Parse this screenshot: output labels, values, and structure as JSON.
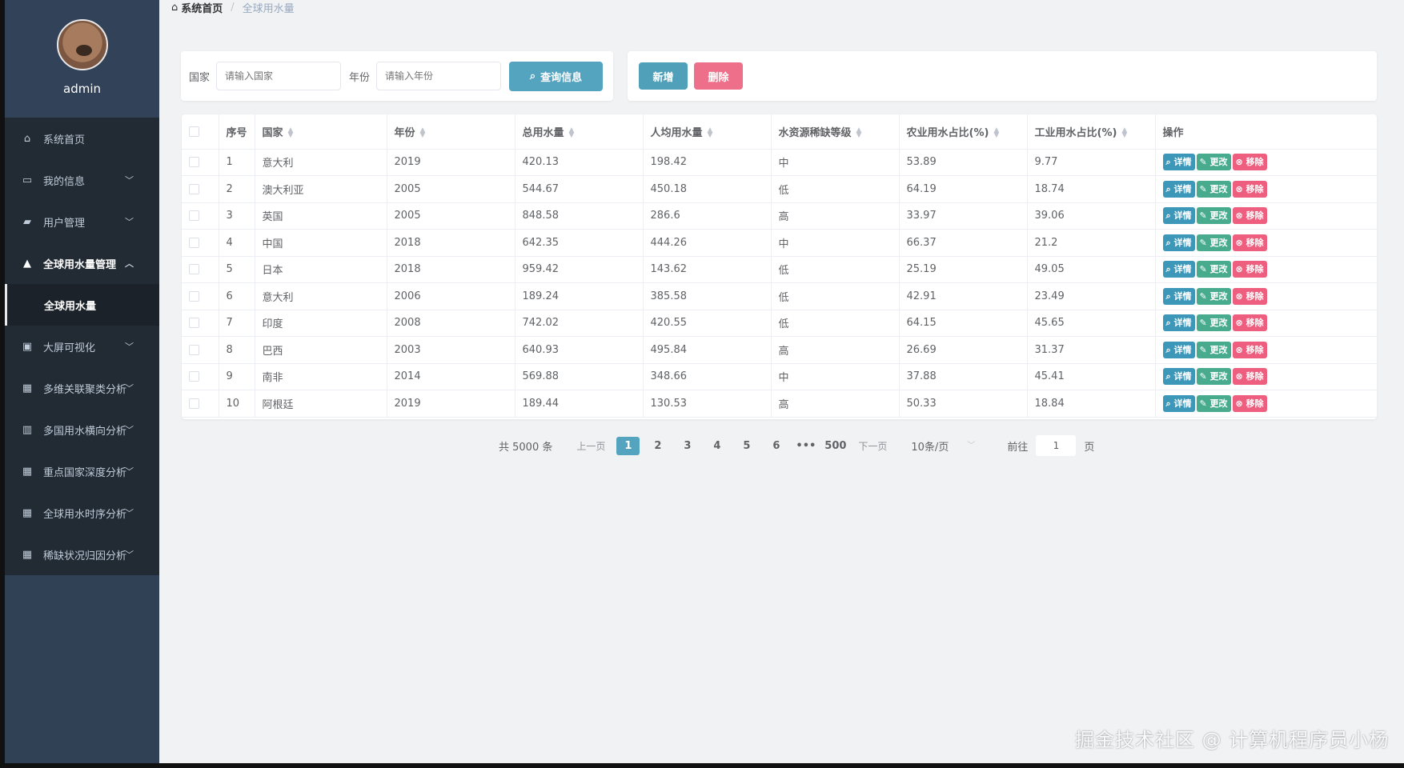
{
  "sidebar": {
    "username": "admin",
    "menu": [
      {
        "label": "系统首页",
        "icon": "home-icon",
        "glyph": "⌂",
        "caret": ""
      },
      {
        "label": "我的信息",
        "icon": "id-card-icon",
        "glyph": "▭",
        "caret": "﹀"
      },
      {
        "label": "用户管理",
        "icon": "user-group-icon",
        "glyph": "▰",
        "caret": "﹀"
      },
      {
        "label": "全球用水量管理",
        "icon": "user-icon",
        "glyph": "▲",
        "caret": "︿"
      }
    ],
    "submenu_label": "全球用水量",
    "menu_after": [
      {
        "label": "大屏可视化",
        "icon": "clipboard-icon",
        "glyph": "▣",
        "caret": "﹀"
      },
      {
        "label": "多维关联聚类分析",
        "icon": "grid-icon",
        "glyph": "▦",
        "caret": "﹀"
      },
      {
        "label": "多国用水横向分析",
        "icon": "book-icon",
        "glyph": "▥",
        "caret": "﹀"
      },
      {
        "label": "重点国家深度分析",
        "icon": "grid-icon",
        "glyph": "▦",
        "caret": "﹀"
      },
      {
        "label": "全球用水时序分析",
        "icon": "grid-icon",
        "glyph": "▦",
        "caret": "﹀"
      },
      {
        "label": "稀缺状况归因分析",
        "icon": "grid-icon",
        "glyph": "▦",
        "caret": "﹀"
      }
    ]
  },
  "breadcrumb": {
    "home": "系统首页",
    "current": "全球用水量"
  },
  "search": {
    "country_label": "国家",
    "country_placeholder": "请输入国家",
    "year_label": "年份",
    "year_placeholder": "请输入年份",
    "button_label": "查询信息"
  },
  "actions": {
    "add_label": "新增",
    "delete_label": "删除"
  },
  "table": {
    "columns": [
      "序号",
      "国家",
      "年份",
      "总用水量",
      "人均用水量",
      "水资源稀缺等级",
      "农业用水占比(%)",
      "工业用水占比(%)",
      "操作"
    ],
    "op_labels": {
      "detail": "详情",
      "edit": "更改",
      "remove": "移除"
    },
    "rows": [
      [
        "1",
        "意大利",
        "2019",
        "420.13",
        "198.42",
        "中",
        "53.89",
        "9.77"
      ],
      [
        "2",
        "澳大利亚",
        "2005",
        "544.67",
        "450.18",
        "低",
        "64.19",
        "18.74"
      ],
      [
        "3",
        "英国",
        "2005",
        "848.58",
        "286.6",
        "高",
        "33.97",
        "39.06"
      ],
      [
        "4",
        "中国",
        "2018",
        "642.35",
        "444.26",
        "中",
        "66.37",
        "21.2"
      ],
      [
        "5",
        "日本",
        "2018",
        "959.42",
        "143.62",
        "低",
        "25.19",
        "49.05"
      ],
      [
        "6",
        "意大利",
        "2006",
        "189.24",
        "385.58",
        "低",
        "42.91",
        "23.49"
      ],
      [
        "7",
        "印度",
        "2008",
        "742.02",
        "420.55",
        "低",
        "64.15",
        "45.65"
      ],
      [
        "8",
        "巴西",
        "2003",
        "640.93",
        "495.84",
        "高",
        "26.69",
        "31.37"
      ],
      [
        "9",
        "南非",
        "2014",
        "569.88",
        "348.66",
        "中",
        "37.88",
        "45.41"
      ],
      [
        "10",
        "阿根廷",
        "2019",
        "189.44",
        "130.53",
        "高",
        "50.33",
        "18.84"
      ]
    ]
  },
  "pagination": {
    "total": "共 5000 条",
    "prev": "上一页",
    "pages": [
      "1",
      "2",
      "3",
      "4",
      "5",
      "6",
      "•••",
      "500"
    ],
    "active_page": "1",
    "next": "下一页",
    "page_size": "10条/页",
    "goto_label": "前往",
    "goto_value": "1",
    "goto_suffix": "页"
  },
  "watermark": "掘金技术社区 @ 计算机程序员小杨",
  "colors": {
    "sidebar": "#304156",
    "accent": "#54a3bf",
    "danger": "#ee6f8a",
    "success": "#49ab8d"
  }
}
